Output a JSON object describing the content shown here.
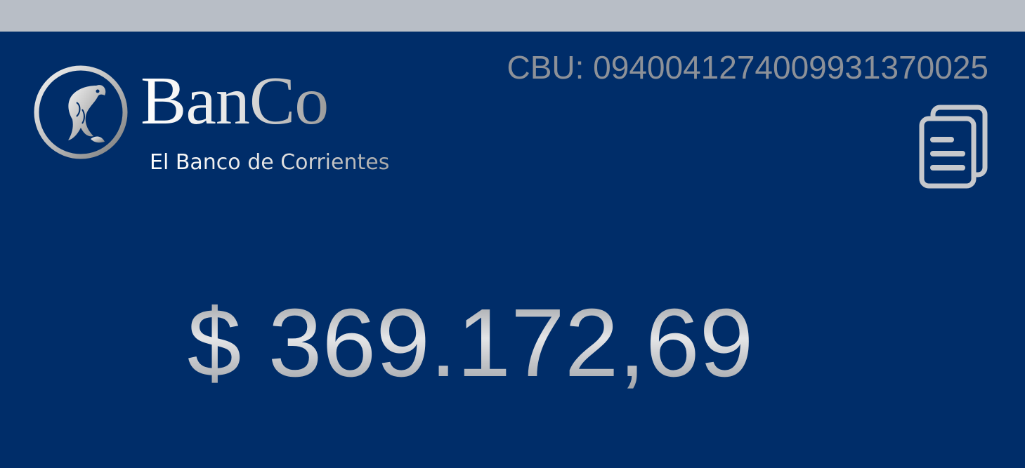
{
  "brand": {
    "name": "BanCo",
    "tagline": "El Banco de Corrientes",
    "logo_icon": "fish-emblem-icon"
  },
  "account": {
    "cbu_text": "CBU: 0940041274009931370025",
    "copy_icon": "copy-documents-icon"
  },
  "balance": {
    "amount_text": "$ 369.172,69"
  },
  "colors": {
    "background": "#002d69",
    "top_strip": "#b8bec6",
    "silver": "#c4c6ca",
    "cbu_gray": "#8d9198"
  }
}
